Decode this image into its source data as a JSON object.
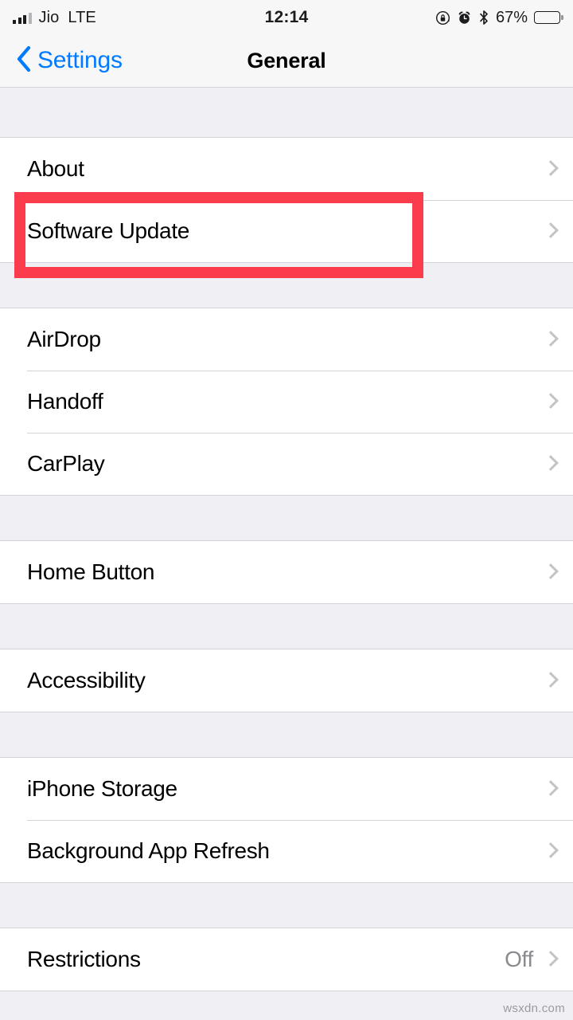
{
  "status_bar": {
    "carrier": "Jio",
    "network": "LTE",
    "time": "12:14",
    "battery_percent": "67%",
    "battery_level": 67,
    "icons": [
      "signal-bars-icon",
      "rotation-lock-icon",
      "alarm-clock-icon",
      "bluetooth-icon",
      "battery-icon"
    ]
  },
  "nav_bar": {
    "back_label": "Settings",
    "title": "General"
  },
  "sections": [
    {
      "rows": [
        {
          "label": "About",
          "value": "",
          "highlighted": false
        },
        {
          "label": "Software Update",
          "value": "",
          "highlighted": true
        }
      ]
    },
    {
      "rows": [
        {
          "label": "AirDrop",
          "value": "",
          "highlighted": false
        },
        {
          "label": "Handoff",
          "value": "",
          "highlighted": false
        },
        {
          "label": "CarPlay",
          "value": "",
          "highlighted": false
        }
      ]
    },
    {
      "rows": [
        {
          "label": "Home Button",
          "value": "",
          "highlighted": false
        }
      ]
    },
    {
      "rows": [
        {
          "label": "Accessibility",
          "value": "",
          "highlighted": false
        }
      ]
    },
    {
      "rows": [
        {
          "label": "iPhone Storage",
          "value": "",
          "highlighted": false
        },
        {
          "label": "Background App Refresh",
          "value": "",
          "highlighted": false
        }
      ]
    },
    {
      "rows": [
        {
          "label": "Restrictions",
          "value": "Off",
          "highlighted": false
        }
      ]
    }
  ],
  "annotation": {
    "target_row": "Software Update",
    "color": "#FA3C4C"
  },
  "watermark": {
    "text": "wsxdn.com"
  },
  "colors": {
    "accent_blue": "#007AFF",
    "group_background": "#EFEFF4",
    "row_background": "#FFFFFF",
    "separator": "#D3D3D8",
    "secondary_text": "#8A8A8F",
    "annotation_red": "#FA3C4C"
  }
}
